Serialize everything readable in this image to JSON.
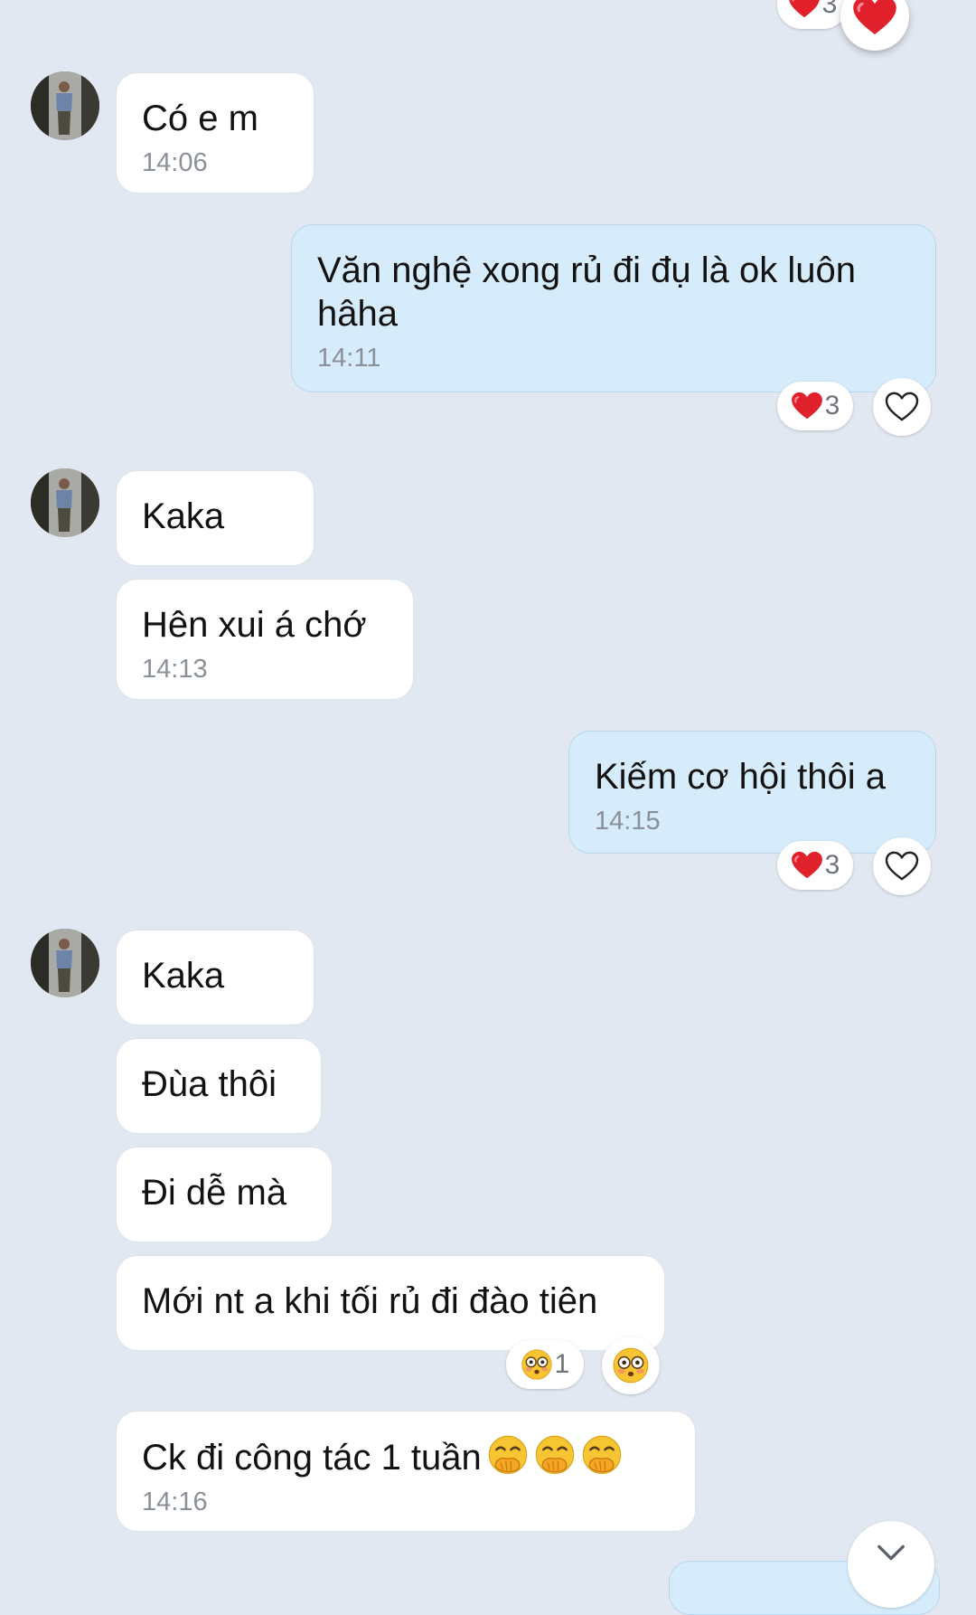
{
  "colors": {
    "background": "#e2e8f1",
    "incoming_bubble": "#ffffff",
    "outgoing_bubble": "#d6ecfb",
    "timestamp": "#8a9098",
    "heart": "#e0202b"
  },
  "messages": [
    {
      "direction": "incoming",
      "text": "Có e m",
      "time": "14:06"
    },
    {
      "direction": "outgoing",
      "text": "Văn nghệ xong rủ đi đụ là ok luôn\nhâha",
      "time": "14:11",
      "reaction": {
        "icon": "heart-icon",
        "count": "3"
      }
    },
    {
      "direction": "incoming",
      "text": "Kaka"
    },
    {
      "direction": "incoming",
      "text": "Hên xui á chớ",
      "time": "14:13"
    },
    {
      "direction": "outgoing",
      "text": "Kiếm cơ hội thôi a",
      "time": "14:15",
      "reaction": {
        "icon": "heart-icon",
        "count": "3"
      }
    },
    {
      "direction": "incoming",
      "text": "Kaka"
    },
    {
      "direction": "incoming",
      "text": "Đùa thôi"
    },
    {
      "direction": "incoming",
      "text": "Đi dễ mà"
    },
    {
      "direction": "incoming",
      "text": "Mới nt a khi tối rủ đi đào tiên",
      "reaction": {
        "icon": "flushed-face-icon",
        "count": "1"
      }
    },
    {
      "direction": "incoming",
      "text": "Ck đi công tác 1 tuần",
      "emojis": [
        "hand-over-mouth-icon",
        "hand-over-mouth-icon",
        "hand-over-mouth-icon"
      ],
      "time": "14:16"
    }
  ],
  "top_partial": {
    "reaction_count": "3"
  }
}
